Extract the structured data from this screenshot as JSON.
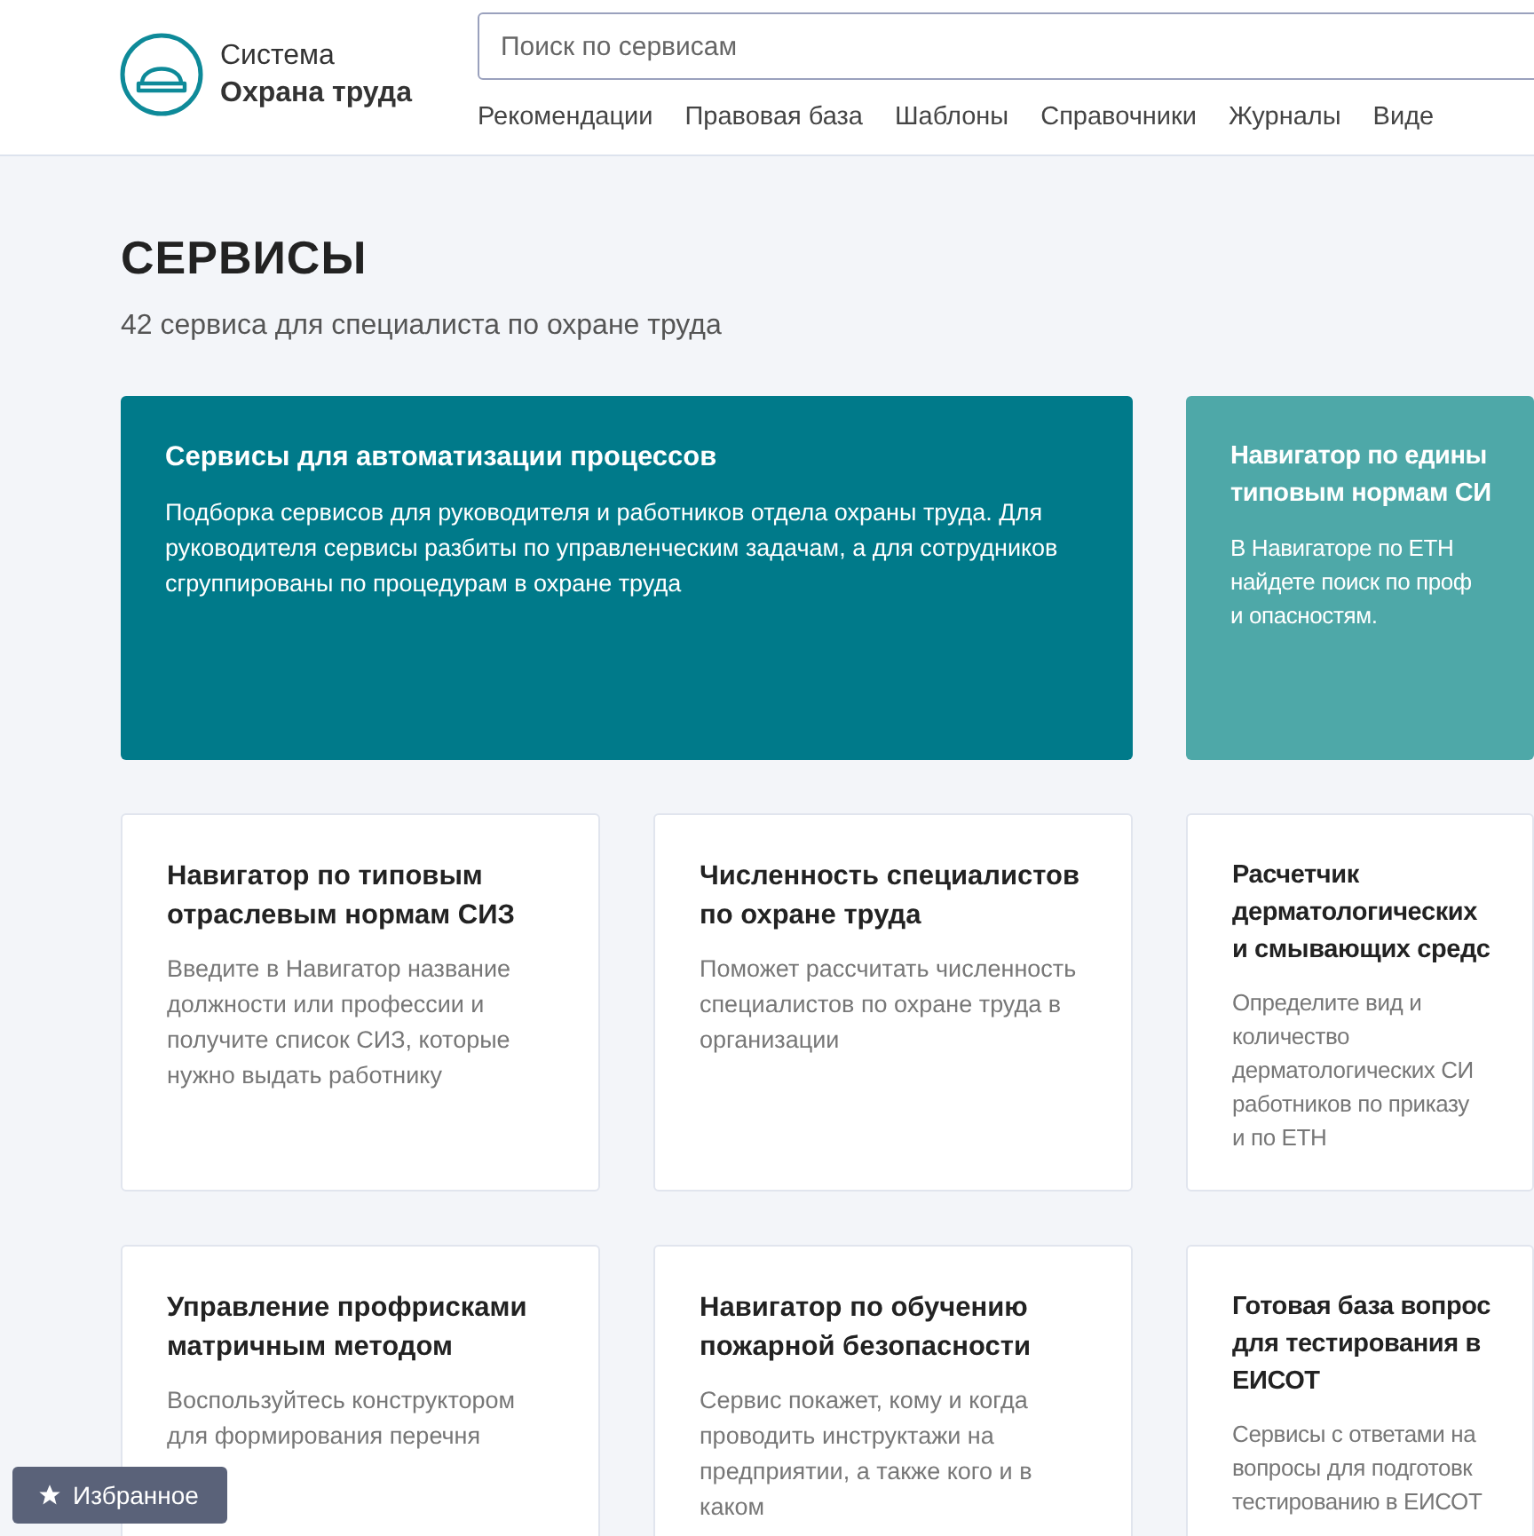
{
  "header": {
    "logo": {
      "line1": "Система",
      "line2": "Охрана труда"
    },
    "search": {
      "placeholder": "Поиск по сервисам"
    },
    "nav": [
      "Рекомендации",
      "Правовая база",
      "Шаблоны",
      "Справочники",
      "Журналы",
      "Виде"
    ]
  },
  "page": {
    "title": "СЕРВИСЫ",
    "subtitle": "42 сервиса для специалиста по охране труда"
  },
  "cards": [
    {
      "kind": "featured",
      "color": "#007a8a",
      "title": "Сервисы для автоматизации процессов",
      "description": "Подборка сервисов для руководителя и работников отдела охраны труда. Для руководителя сервисы разбиты по управленческим задачам, а для сотрудников сгруппированы по процедурам в охране труда"
    },
    {
      "kind": "featured",
      "color": "#4ea8a8",
      "title": "Навигатор по едины\nтиповым нормам СИ",
      "description": "В Навигаторе по ЕТН\nнайдете поиск по проф\nи опасностям."
    },
    {
      "kind": "regular",
      "title": "Навигатор по типовым отраслевым нормам СИЗ",
      "description": "Введите в Навигатор название должности или профессии и получите список СИЗ, которые нужно выдать работнику"
    },
    {
      "kind": "regular",
      "title": "Численность специалистов по охране труда",
      "description": "Поможет рассчитать численность специалистов по охране труда в организации"
    },
    {
      "kind": "regular",
      "title": "Расчетчик\nдерматологических\nи смывающих средс",
      "description": "Определите вид и\nколичество\nдерматологических СИ\nработников по приказу\nи по ЕТН"
    },
    {
      "kind": "regular",
      "title": "Управление профрисками матричным методом",
      "description": "Воспользуйтесь конструктором для формирования перечня"
    },
    {
      "kind": "regular",
      "title": "Навигатор по обучению пожарной безопасности",
      "description": "Сервис покажет, кому и когда проводить инструктажи на предприятии, а также кого и в каком"
    },
    {
      "kind": "regular",
      "title": "Готовая база вопрос\nдля тестирования в\nЕИСОТ",
      "description": "Сервисы с ответами на\nвопросы для подготовк\nтестированию в ЕИСОТ"
    }
  ],
  "favorites_button": {
    "label": "Избранное"
  }
}
